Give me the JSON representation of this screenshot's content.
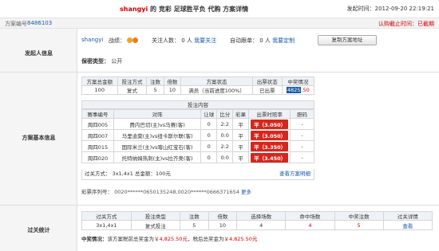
{
  "header": {
    "user": "shangyi",
    "title_rest": "的 竞彩 足球胜平负 代购 方案详情",
    "time_label": "发起时间：",
    "time_value": "2012-09-20 22:19:21"
  },
  "idbar": {
    "label": "方案编号",
    "value": "8486103",
    "deadline": "认购截止时间：已截期"
  },
  "sections": {
    "sponsor": "发起人信息",
    "plan": "方案基本信息",
    "pass": "过关统计"
  },
  "sponsor": {
    "username": "shangyi",
    "record_label": "战绩：",
    "follow_label": "关注人数：",
    "follow_count": "0 人",
    "follow_link": "我要关注",
    "autofollow_label": "自动跟单：",
    "autofollow_count": "0 人",
    "autofollow_link": "我要定制",
    "copy_button": "复制方案地址",
    "privacy_label": "保密类型：",
    "privacy_value": "公开"
  },
  "summary": {
    "headers": [
      "方案总金额",
      "投注方式",
      "注数",
      "倍数",
      "方案状态",
      "出票状态",
      "中奖情况"
    ],
    "row": {
      "amount": "100",
      "mode": "复式",
      "bets": "5",
      "multiple": "10",
      "status": "满员（当前进度100%）",
      "ticket": "已出票",
      "prize_hl": "4825",
      "prize_rest": ".50"
    }
  },
  "content": {
    "title": "投注内容",
    "headers": [
      "赛事编号",
      "对阵",
      "让球",
      "比分",
      "彩果",
      "出票时赔率",
      "胆码"
    ],
    "rows": [
      {
        "id": "周四005",
        "match": "费内巴切(主)vs马赛(客)",
        "handicap": "0",
        "score": "2:2",
        "result": "平",
        "odds": "平（3.050）",
        "banker": "-"
      },
      {
        "id": "周四007",
        "match": "马里迪莫(主)vs纽卡斯尔联(客)",
        "handicap": "0",
        "score": "0:0",
        "result": "平",
        "odds": "平（3.050）",
        "banker": "-"
      },
      {
        "id": "周四015",
        "match": "国际米兰(主)vs喀山红宝石(客)",
        "handicap": "0",
        "score": "2:2",
        "result": "平",
        "odds": "平（3.350）",
        "banker": "-"
      },
      {
        "id": "周四020",
        "match": "托特纳姆热刺(主)vs拉齐奥(客)",
        "handicap": "0",
        "score": "0:0",
        "result": "平",
        "odds": "平（3.450）",
        "banker": "-"
      }
    ],
    "passinfo": "过关方式：  3x1,4x1 总金额：100元",
    "view_link": "查看方案明细"
  },
  "seqno": {
    "label": "彩票序列号：",
    "value": "0020******0650135248,0020******0666371654",
    "more": "更多"
  },
  "pass": {
    "headers": [
      "过关方式",
      "投注类型",
      "注数",
      "倍数",
      "选择场数",
      "命中场数",
      "中奖注数",
      "过关详情"
    ],
    "row": {
      "mode": "3x1,4x1",
      "type": "复式投注",
      "bets": "5",
      "multiple": "10",
      "selected": "4",
      "hit": "4",
      "win_bets": "5",
      "detail": "查看"
    },
    "prize_label": "中奖情况：",
    "prize_text1": "该方案税前总奖金为",
    "prize_value1": "￥4,825.50元",
    "prize_text2": "，税后总奖金为",
    "prize_value2": "￥4,825.50元"
  }
}
